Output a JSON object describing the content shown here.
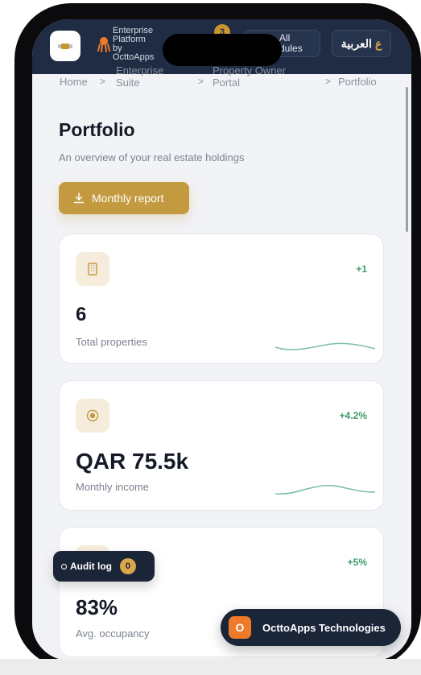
{
  "header": {
    "brand_lines": [
      "Enterprise",
      "Platform",
      "by",
      "OcttoApps"
    ],
    "notification_count": "3",
    "modules_label_line1": "All",
    "modules_label_line2": "dules",
    "language_label": "العربية",
    "language_glyph": "ع"
  },
  "breadcrumb": {
    "home": "Home",
    "suite_line1": "Enterprise",
    "suite_line2": "Suite",
    "portal_line1": "Property Owner",
    "portal_line2": "Portal",
    "current": "Portfolio",
    "separator": ">"
  },
  "page": {
    "title": "Portfolio",
    "subtitle": "An overview of your real estate holdings",
    "report_button": "Monthly report"
  },
  "stats": [
    {
      "value": "6",
      "label": "Total properties",
      "delta": "+1",
      "icon": "building-icon"
    },
    {
      "value": "QAR 75.5k",
      "label": "Monthly income",
      "delta": "+4.2%",
      "icon": "coin-icon"
    },
    {
      "value": "83%",
      "label": "Avg. occupancy",
      "delta": "+5%",
      "icon": "occupancy-icon"
    }
  ],
  "audit": {
    "label": "Audit log",
    "count": "0"
  },
  "company": {
    "name": "OcttoApps Technologies",
    "initial": "O"
  },
  "colors": {
    "header_bg": "#1f2c44",
    "accent_gold": "#c39a3f",
    "positive_green": "#3d9b6a",
    "company_logo": "#ee7a2a"
  }
}
